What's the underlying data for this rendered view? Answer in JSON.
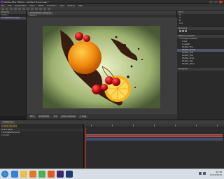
{
  "window": {
    "title": "Adobe After Effects - Untitled Project.aep *"
  },
  "menu": [
    "File",
    "Edit",
    "Composition",
    "Layer",
    "Effect",
    "Animation",
    "View",
    "Window",
    "Help"
  ],
  "project_panel": {
    "header": "Project ▾",
    "items": [
      {
        "label": "Comp 1",
        "selected": false
      },
      {
        "label": "Orange&Cherry.png",
        "selected": true
      }
    ]
  },
  "composition_panel": {
    "tab": "Composition: Comp 1 ▾",
    "subtab": "Comp 1",
    "footer": {
      "zoom": "50%",
      "time": "0;00;00;00",
      "quality": "Full",
      "camera": "Active Camera",
      "views": "1 View"
    }
  },
  "right_panel": {
    "info": {
      "header": "Info ▾",
      "values": [
        "R:",
        "G:",
        "B:",
        "A: 0",
        "X: 540",
        "Y: 88"
      ]
    },
    "preview_header": "Preview ▾",
    "effects_header": "Effects & Presets ▾",
    "effects_rows": [
      {
        "label": "* Animation Presets",
        "hl": false
      },
      {
        "label": "▾ Text",
        "hl": false
      },
      {
        "label": "▾ Shatter",
        "hl": false
      },
      {
        "label": "  Shatter_Flip",
        "hl": false
      },
      {
        "label": "  Shatter_Puzzle",
        "hl": true
      },
      {
        "label": "  Shatter_Grid",
        "hl": false
      },
      {
        "label": "  Shatter_Star",
        "hl": false
      },
      {
        "label": "  Shatter_Brick",
        "hl": false
      },
      {
        "label": "  Shatter_Hex",
        "hl": false
      },
      {
        "label": "  Shatter_Wave",
        "hl": false
      }
    ],
    "paint_header": "Paragraph"
  },
  "timeline": {
    "tab": "Comp 1 ×",
    "time": "0;00;00;00",
    "columns": "Source Name",
    "layers": [
      "1  Orange&Cherry.png",
      "2  Comp 1"
    ]
  },
  "taskbar": {
    "icons": [
      "ie",
      "explorer",
      "media",
      "chrome",
      "firefox",
      "ae",
      "photoshop"
    ],
    "time": "20:38",
    "date": "17/02/2016"
  },
  "colors": {
    "accent": "#d03030",
    "timecode": "#e0b040",
    "layer_bar": "#8a3d3d"
  }
}
